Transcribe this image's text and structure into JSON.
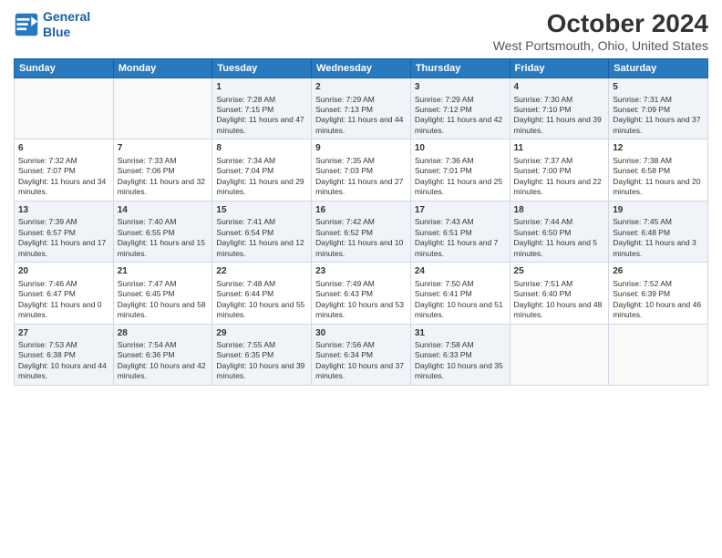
{
  "header": {
    "logo_line1": "General",
    "logo_line2": "Blue",
    "main_title": "October 2024",
    "subtitle": "West Portsmouth, Ohio, United States"
  },
  "days_of_week": [
    "Sunday",
    "Monday",
    "Tuesday",
    "Wednesday",
    "Thursday",
    "Friday",
    "Saturday"
  ],
  "weeks": [
    [
      {
        "day": "",
        "sunrise": "",
        "sunset": "",
        "daylight": ""
      },
      {
        "day": "",
        "sunrise": "",
        "sunset": "",
        "daylight": ""
      },
      {
        "day": "1",
        "sunrise": "Sunrise: 7:28 AM",
        "sunset": "Sunset: 7:15 PM",
        "daylight": "Daylight: 11 hours and 47 minutes."
      },
      {
        "day": "2",
        "sunrise": "Sunrise: 7:29 AM",
        "sunset": "Sunset: 7:13 PM",
        "daylight": "Daylight: 11 hours and 44 minutes."
      },
      {
        "day": "3",
        "sunrise": "Sunrise: 7:29 AM",
        "sunset": "Sunset: 7:12 PM",
        "daylight": "Daylight: 11 hours and 42 minutes."
      },
      {
        "day": "4",
        "sunrise": "Sunrise: 7:30 AM",
        "sunset": "Sunset: 7:10 PM",
        "daylight": "Daylight: 11 hours and 39 minutes."
      },
      {
        "day": "5",
        "sunrise": "Sunrise: 7:31 AM",
        "sunset": "Sunset: 7:09 PM",
        "daylight": "Daylight: 11 hours and 37 minutes."
      }
    ],
    [
      {
        "day": "6",
        "sunrise": "Sunrise: 7:32 AM",
        "sunset": "Sunset: 7:07 PM",
        "daylight": "Daylight: 11 hours and 34 minutes."
      },
      {
        "day": "7",
        "sunrise": "Sunrise: 7:33 AM",
        "sunset": "Sunset: 7:06 PM",
        "daylight": "Daylight: 11 hours and 32 minutes."
      },
      {
        "day": "8",
        "sunrise": "Sunrise: 7:34 AM",
        "sunset": "Sunset: 7:04 PM",
        "daylight": "Daylight: 11 hours and 29 minutes."
      },
      {
        "day": "9",
        "sunrise": "Sunrise: 7:35 AM",
        "sunset": "Sunset: 7:03 PM",
        "daylight": "Daylight: 11 hours and 27 minutes."
      },
      {
        "day": "10",
        "sunrise": "Sunrise: 7:36 AM",
        "sunset": "Sunset: 7:01 PM",
        "daylight": "Daylight: 11 hours and 25 minutes."
      },
      {
        "day": "11",
        "sunrise": "Sunrise: 7:37 AM",
        "sunset": "Sunset: 7:00 PM",
        "daylight": "Daylight: 11 hours and 22 minutes."
      },
      {
        "day": "12",
        "sunrise": "Sunrise: 7:38 AM",
        "sunset": "Sunset: 6:58 PM",
        "daylight": "Daylight: 11 hours and 20 minutes."
      }
    ],
    [
      {
        "day": "13",
        "sunrise": "Sunrise: 7:39 AM",
        "sunset": "Sunset: 6:57 PM",
        "daylight": "Daylight: 11 hours and 17 minutes."
      },
      {
        "day": "14",
        "sunrise": "Sunrise: 7:40 AM",
        "sunset": "Sunset: 6:55 PM",
        "daylight": "Daylight: 11 hours and 15 minutes."
      },
      {
        "day": "15",
        "sunrise": "Sunrise: 7:41 AM",
        "sunset": "Sunset: 6:54 PM",
        "daylight": "Daylight: 11 hours and 12 minutes."
      },
      {
        "day": "16",
        "sunrise": "Sunrise: 7:42 AM",
        "sunset": "Sunset: 6:52 PM",
        "daylight": "Daylight: 11 hours and 10 minutes."
      },
      {
        "day": "17",
        "sunrise": "Sunrise: 7:43 AM",
        "sunset": "Sunset: 6:51 PM",
        "daylight": "Daylight: 11 hours and 7 minutes."
      },
      {
        "day": "18",
        "sunrise": "Sunrise: 7:44 AM",
        "sunset": "Sunset: 6:50 PM",
        "daylight": "Daylight: 11 hours and 5 minutes."
      },
      {
        "day": "19",
        "sunrise": "Sunrise: 7:45 AM",
        "sunset": "Sunset: 6:48 PM",
        "daylight": "Daylight: 11 hours and 3 minutes."
      }
    ],
    [
      {
        "day": "20",
        "sunrise": "Sunrise: 7:46 AM",
        "sunset": "Sunset: 6:47 PM",
        "daylight": "Daylight: 11 hours and 0 minutes."
      },
      {
        "day": "21",
        "sunrise": "Sunrise: 7:47 AM",
        "sunset": "Sunset: 6:45 PM",
        "daylight": "Daylight: 10 hours and 58 minutes."
      },
      {
        "day": "22",
        "sunrise": "Sunrise: 7:48 AM",
        "sunset": "Sunset: 6:44 PM",
        "daylight": "Daylight: 10 hours and 55 minutes."
      },
      {
        "day": "23",
        "sunrise": "Sunrise: 7:49 AM",
        "sunset": "Sunset: 6:43 PM",
        "daylight": "Daylight: 10 hours and 53 minutes."
      },
      {
        "day": "24",
        "sunrise": "Sunrise: 7:50 AM",
        "sunset": "Sunset: 6:41 PM",
        "daylight": "Daylight: 10 hours and 51 minutes."
      },
      {
        "day": "25",
        "sunrise": "Sunrise: 7:51 AM",
        "sunset": "Sunset: 6:40 PM",
        "daylight": "Daylight: 10 hours and 48 minutes."
      },
      {
        "day": "26",
        "sunrise": "Sunrise: 7:52 AM",
        "sunset": "Sunset: 6:39 PM",
        "daylight": "Daylight: 10 hours and 46 minutes."
      }
    ],
    [
      {
        "day": "27",
        "sunrise": "Sunrise: 7:53 AM",
        "sunset": "Sunset: 6:38 PM",
        "daylight": "Daylight: 10 hours and 44 minutes."
      },
      {
        "day": "28",
        "sunrise": "Sunrise: 7:54 AM",
        "sunset": "Sunset: 6:36 PM",
        "daylight": "Daylight: 10 hours and 42 minutes."
      },
      {
        "day": "29",
        "sunrise": "Sunrise: 7:55 AM",
        "sunset": "Sunset: 6:35 PM",
        "daylight": "Daylight: 10 hours and 39 minutes."
      },
      {
        "day": "30",
        "sunrise": "Sunrise: 7:56 AM",
        "sunset": "Sunset: 6:34 PM",
        "daylight": "Daylight: 10 hours and 37 minutes."
      },
      {
        "day": "31",
        "sunrise": "Sunrise: 7:58 AM",
        "sunset": "Sunset: 6:33 PM",
        "daylight": "Daylight: 10 hours and 35 minutes."
      },
      {
        "day": "",
        "sunrise": "",
        "sunset": "",
        "daylight": ""
      },
      {
        "day": "",
        "sunrise": "",
        "sunset": "",
        "daylight": ""
      }
    ]
  ]
}
